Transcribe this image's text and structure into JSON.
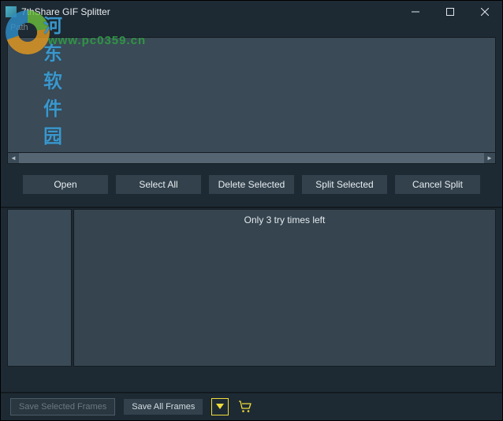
{
  "titlebar": {
    "app_name": "7thShare GIF Splitter"
  },
  "path": {
    "label": "Path"
  },
  "actions": {
    "open": "Open",
    "select_all": "Select All",
    "delete_selected": "Delete Selected",
    "split_selected": "Split Selected",
    "cancel_split": "Cancel Split"
  },
  "main": {
    "trial_message": "Only 3 try times left"
  },
  "bottom": {
    "save_selected": "Save Selected Frames",
    "save_all": "Save All Frames"
  },
  "watermark": {
    "site_name": "河东软件园",
    "site_url": "www.pc0359.cn"
  }
}
